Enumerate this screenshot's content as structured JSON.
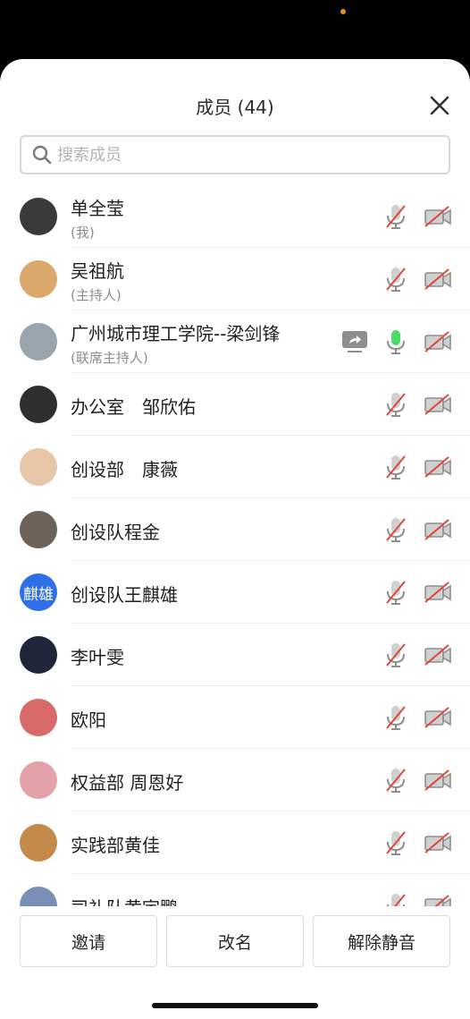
{
  "header": {
    "title": "成员 (44)"
  },
  "search": {
    "placeholder": "搜索成员"
  },
  "members": [
    {
      "name": "单全莹",
      "role": "(我)",
      "mic": "muted",
      "camera": "off",
      "avatar": {
        "bg": "#3a3a3a"
      }
    },
    {
      "name": "吴祖航",
      "role": "(主持人)",
      "mic": "muted",
      "camera": "off",
      "avatar": {
        "bg": "#d9a86a"
      }
    },
    {
      "name": "广州城市理工学院--梁剑锋",
      "role": "(联席主持人)",
      "mic": "active",
      "camera": "off",
      "sharing": true,
      "avatar": {
        "bg": "#9aa4ad"
      }
    },
    {
      "name": "办公室　邹欣佑",
      "mic": "muted",
      "camera": "off",
      "avatar": {
        "bg": "#2f2f2f"
      }
    },
    {
      "name": "创设部　康薇",
      "mic": "muted",
      "camera": "off",
      "avatar": {
        "bg": "#e8c6a8"
      }
    },
    {
      "name": "创设队程金",
      "mic": "muted",
      "camera": "off",
      "avatar": {
        "bg": "#6d6259"
      }
    },
    {
      "name": "创设队王麒雄",
      "mic": "muted",
      "camera": "off",
      "avatar": {
        "bg": "#2f6fe8",
        "text": "麒雄"
      }
    },
    {
      "name": "李叶雯",
      "mic": "muted",
      "camera": "off",
      "avatar": {
        "bg": "#20263a"
      }
    },
    {
      "name": "欧阳",
      "mic": "muted",
      "camera": "off",
      "avatar": {
        "bg": "#d96a6a"
      }
    },
    {
      "name": "权益部 周恩好",
      "mic": "muted",
      "camera": "off",
      "avatar": {
        "bg": "#e3a1a8"
      }
    },
    {
      "name": "实践部黄佳",
      "mic": "muted",
      "camera": "off",
      "avatar": {
        "bg": "#c48a4a"
      }
    },
    {
      "name": "司礼队黄宇鹏",
      "mic": "muted",
      "camera": "off",
      "avatar": {
        "bg": "#7a8fb5"
      }
    }
  ],
  "footer": {
    "invite": "邀请",
    "rename": "改名",
    "unmute": "解除静音"
  },
  "colors": {
    "muted_icon": "#8e8e8e",
    "muted_slash": "#e0463b",
    "active_mic": "#4cd964"
  }
}
